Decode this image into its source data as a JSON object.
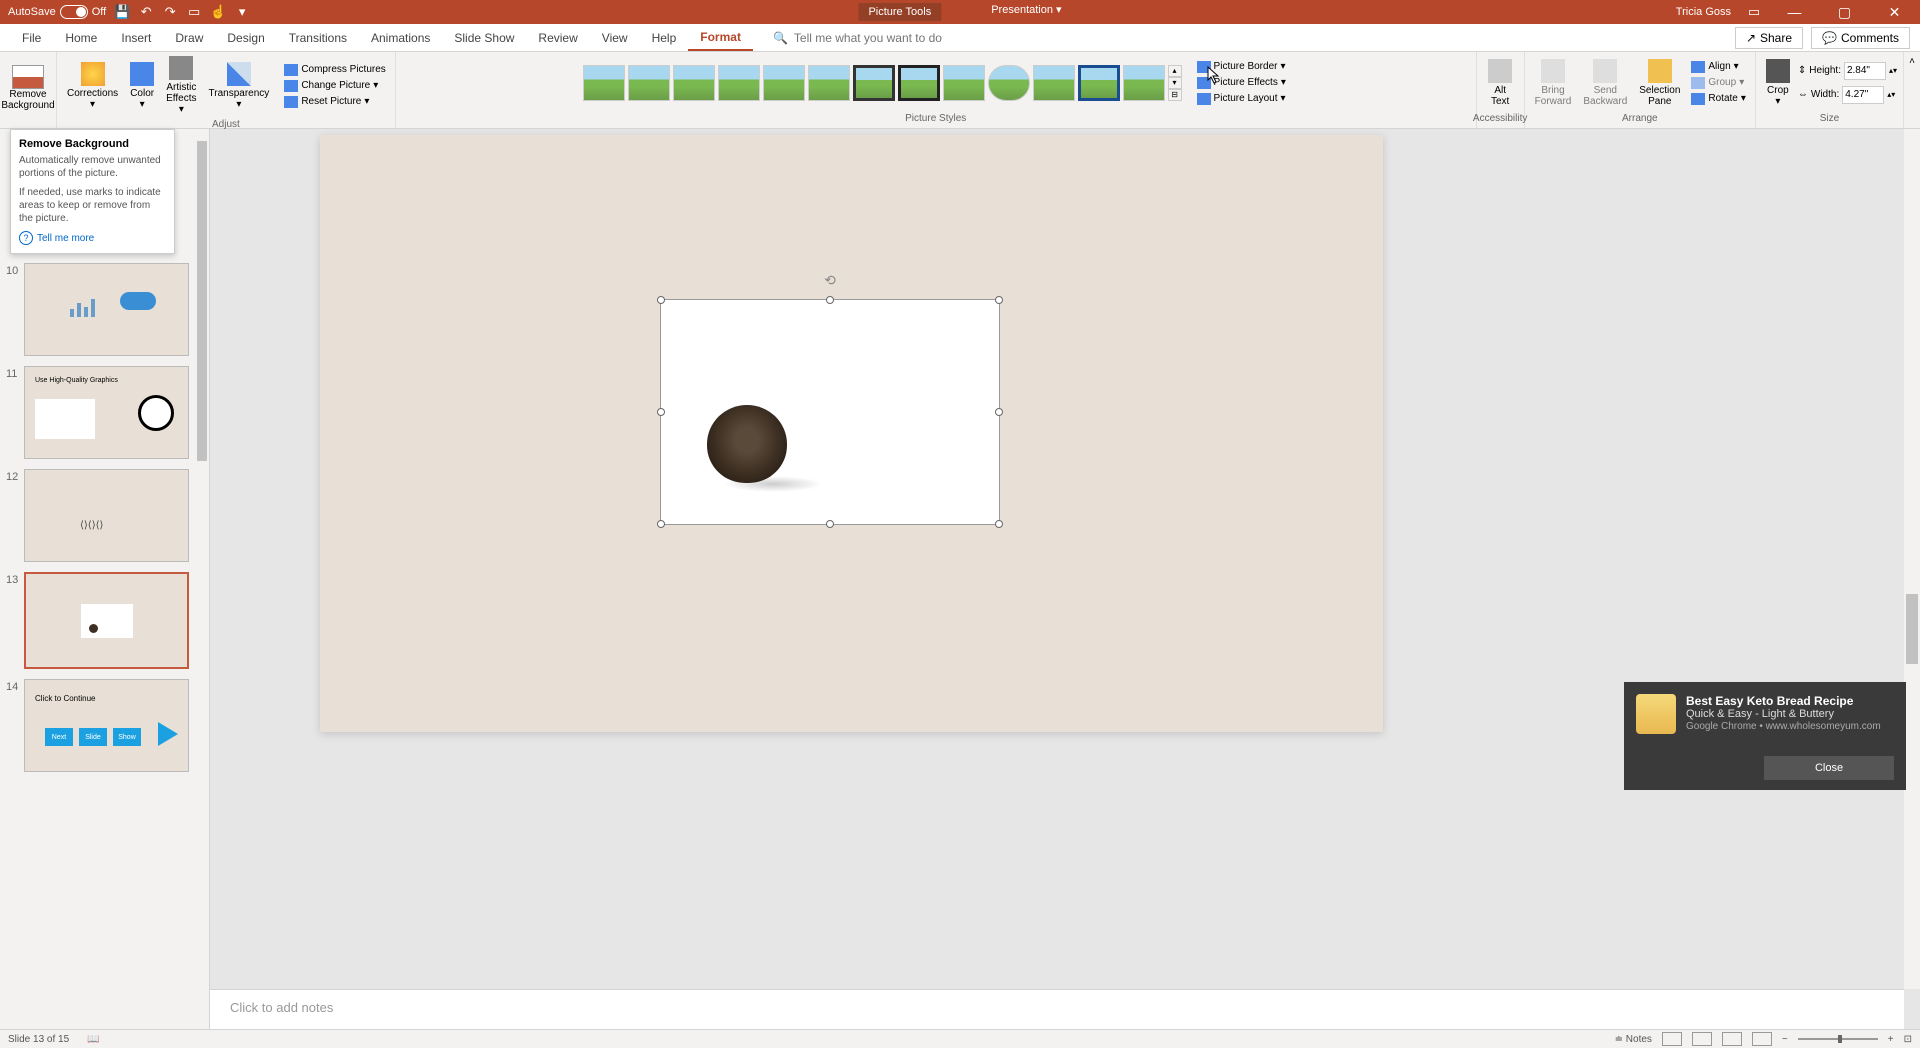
{
  "titleBar": {
    "autoSave": "AutoSave",
    "autoSaveState": "Off",
    "pictureTools": "Picture Tools",
    "presentationName": "Presentation",
    "userName": "Tricia Goss"
  },
  "menu": {
    "file": "File",
    "home": "Home",
    "insert": "Insert",
    "draw": "Draw",
    "design": "Design",
    "transitions": "Transitions",
    "animations": "Animations",
    "slideShow": "Slide Show",
    "review": "Review",
    "view": "View",
    "help": "Help",
    "format": "Format",
    "searchPlaceholder": "Tell me what you want to do",
    "share": "Share",
    "comments": "Comments"
  },
  "ribbon": {
    "removeBg": "Remove\nBackground",
    "corrections": "Corrections",
    "color": "Color",
    "artistic": "Artistic\nEffects",
    "transparency": "Transparency",
    "compress": "Compress Pictures",
    "change": "Change Picture",
    "reset": "Reset Picture",
    "adjust": "Adjust",
    "picStyles": "Picture Styles",
    "picBorder": "Picture Border",
    "picEffects": "Picture Effects",
    "picLayout": "Picture Layout",
    "altText": "Alt\nText",
    "accessibility": "Accessibility",
    "bringFwd": "Bring\nForward",
    "sendBack": "Send\nBackward",
    "selPane": "Selection\nPane",
    "align": "Align",
    "group": "Group",
    "rotate": "Rotate",
    "arrange": "Arrange",
    "crop": "Crop",
    "heightLabel": "Height:",
    "height": "2.84\"",
    "widthLabel": "Width:",
    "width": "4.27\"",
    "size": "Size"
  },
  "tooltip": {
    "title": "Remove Background",
    "p1": "Automatically remove unwanted portions of the picture.",
    "p2": "If needed, use marks to indicate areas to keep or remove from the picture.",
    "tellMore": "Tell me more"
  },
  "slides": {
    "n10": "10",
    "n11": "11",
    "n12": "12",
    "n13": "13",
    "n14": "14",
    "t11": "Use High-Quality Graphics",
    "t14": "Click to Continue",
    "next": "Next",
    "slide": "Slide",
    "show": "Show"
  },
  "notes": {
    "placeholder": "Click to add notes"
  },
  "notification": {
    "title": "Best Easy Keto Bread Recipe",
    "subtitle": "Quick & Easy - Light & Buttery",
    "source": "Google Chrome • www.wholesomeyum.com",
    "close": "Close"
  },
  "status": {
    "slideInfo": "Slide 13 of 15",
    "notes": "Notes"
  }
}
